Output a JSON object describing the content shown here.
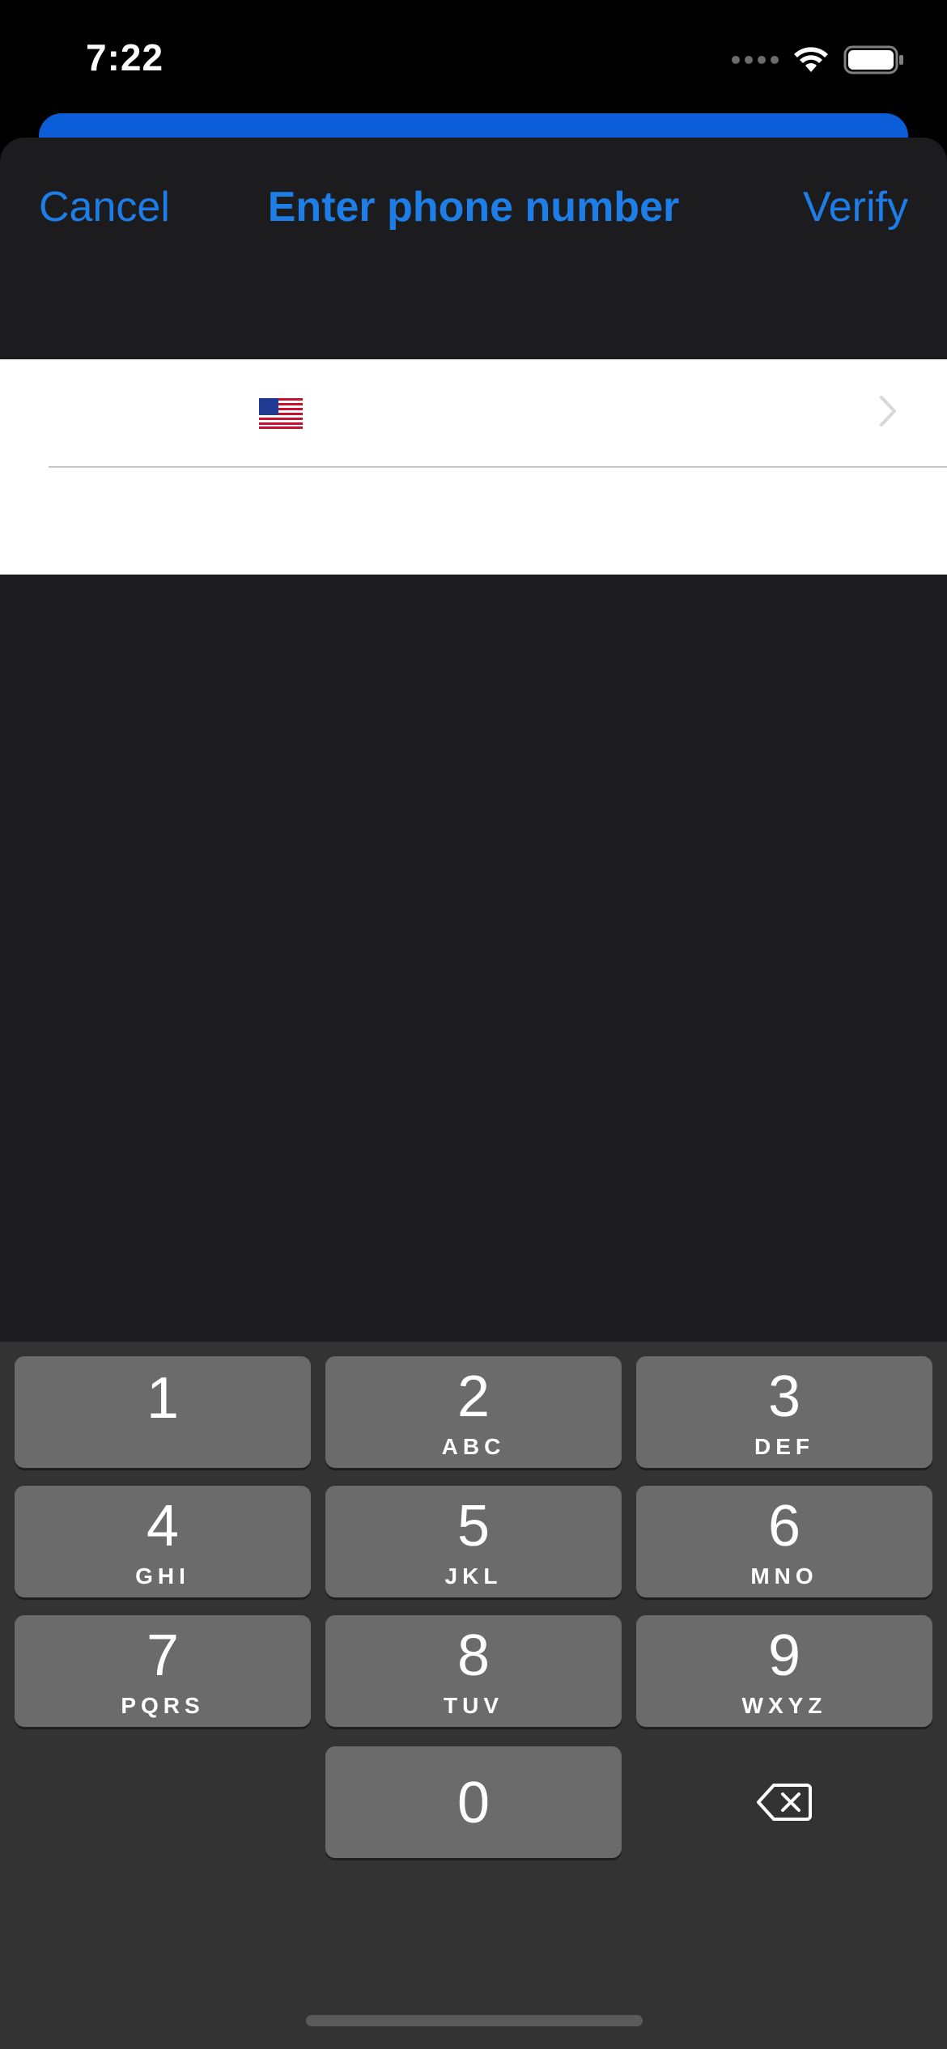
{
  "status_bar": {
    "time": "7:22",
    "icons": [
      "cellular-signal-icon",
      "wifi-icon",
      "battery-icon"
    ]
  },
  "nav": {
    "cancel_label": "Cancel",
    "title": "Enter phone number",
    "verify_label": "Verify"
  },
  "form": {
    "country_flag": "🇺🇸",
    "chevron_icon": "chevron-right-icon",
    "phone_value": "",
    "phone_placeholder": ""
  },
  "keypad": {
    "keys": [
      {
        "digit": "1",
        "letters": ""
      },
      {
        "digit": "2",
        "letters": "ABC"
      },
      {
        "digit": "3",
        "letters": "DEF"
      },
      {
        "digit": "4",
        "letters": "GHI"
      },
      {
        "digit": "5",
        "letters": "JKL"
      },
      {
        "digit": "6",
        "letters": "MNO"
      },
      {
        "digit": "7",
        "letters": "PQRS"
      },
      {
        "digit": "8",
        "letters": "TUV"
      },
      {
        "digit": "9",
        "letters": "WXYZ"
      },
      {
        "digit": "0",
        "letters": ""
      }
    ],
    "delete_icon": "backspace-icon"
  },
  "colors": {
    "accent": "#1e7ee8",
    "sheet_background": "#1c1c1e",
    "keyboard_background": "#333333",
    "key_background": "#6b6b6b"
  }
}
